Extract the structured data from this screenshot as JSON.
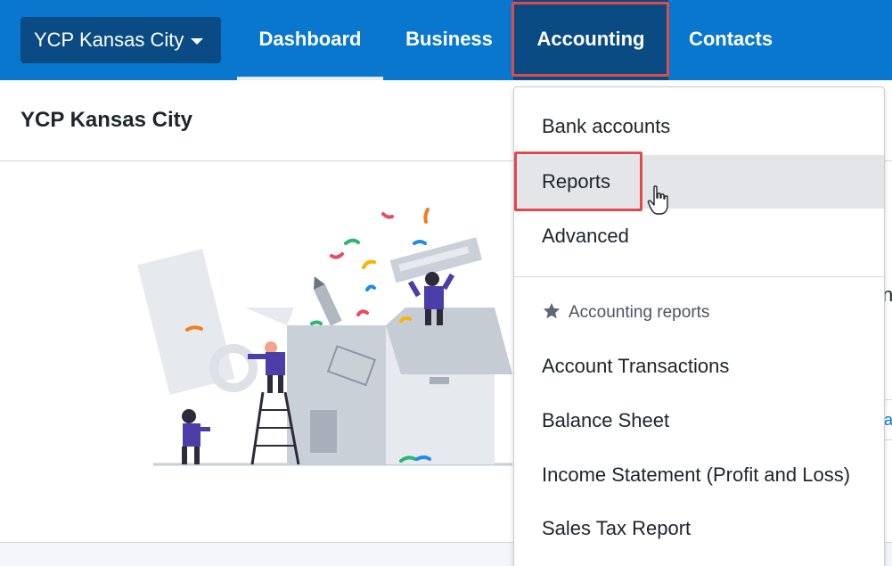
{
  "topbar": {
    "business_switcher": "YCP Kansas City",
    "tabs": [
      {
        "label": "Dashboard"
      },
      {
        "label": "Business"
      },
      {
        "label": "Accounting"
      },
      {
        "label": "Contacts"
      }
    ]
  },
  "page": {
    "title": "YCP Kansas City",
    "edge_text": "n",
    "edge_link": "ai"
  },
  "accounting_menu": {
    "items": [
      {
        "label": "Bank accounts"
      },
      {
        "label": "Reports"
      },
      {
        "label": "Advanced"
      }
    ],
    "section_title": "Accounting reports",
    "reports": [
      {
        "label": "Account Transactions"
      },
      {
        "label": "Balance Sheet"
      },
      {
        "label": "Income Statement (Profit and Loss)"
      },
      {
        "label": "Sales Tax Report"
      }
    ]
  },
  "colors": {
    "topbar": "#0877cd",
    "active_tab": "#0a4b84",
    "highlight": "#e04a4a"
  }
}
